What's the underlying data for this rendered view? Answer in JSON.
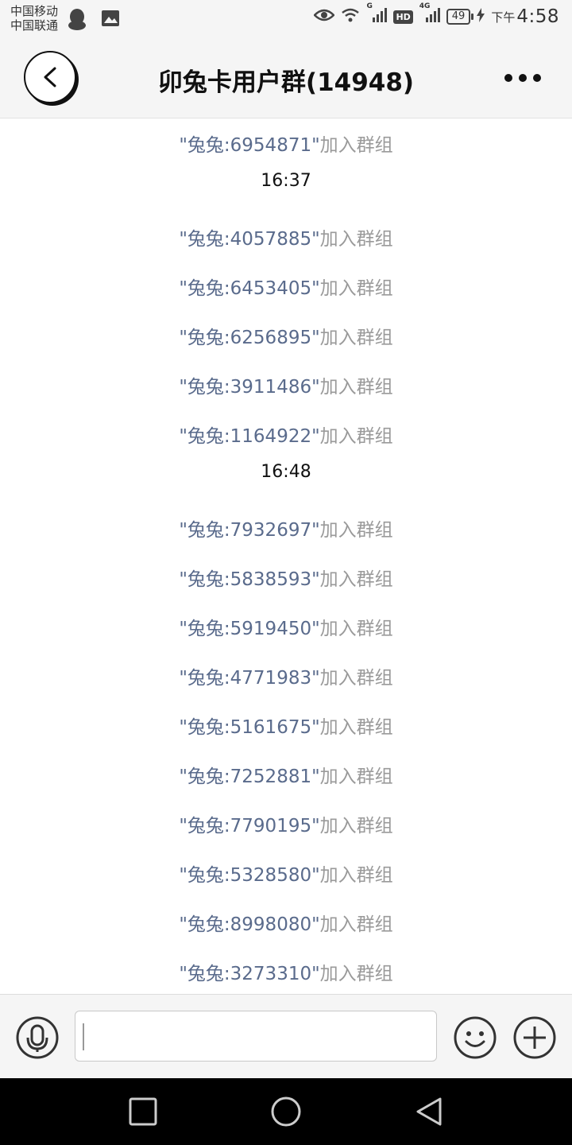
{
  "status_bar": {
    "carrier_1": "中国移动",
    "carrier_2": "中国联通",
    "network_1": "G",
    "network_2": "4G",
    "hd": "HD",
    "battery": "49",
    "ampm": "下午",
    "time": "4:58"
  },
  "header": {
    "title": "卯兔卡用户群(14948)",
    "back_icon": "chevron-left-icon",
    "more_icon": "more-dots-icon"
  },
  "messages": [
    {
      "type": "system",
      "name": "\"兔兔:6954871\"",
      "text": "加入群组"
    },
    {
      "type": "time",
      "text": "16:37"
    },
    {
      "type": "system",
      "name": "\"兔兔:4057885\"",
      "text": "加入群组"
    },
    {
      "type": "system",
      "name": "\"兔兔:6453405\"",
      "text": "加入群组"
    },
    {
      "type": "system",
      "name": "\"兔兔:6256895\"",
      "text": "加入群组"
    },
    {
      "type": "system",
      "name": "\"兔兔:3911486\"",
      "text": "加入群组"
    },
    {
      "type": "system",
      "name": "\"兔兔:1164922\"",
      "text": "加入群组"
    },
    {
      "type": "time",
      "text": "16:48"
    },
    {
      "type": "system",
      "name": "\"兔兔:7932697\"",
      "text": "加入群组"
    },
    {
      "type": "system",
      "name": "\"兔兔:5838593\"",
      "text": "加入群组"
    },
    {
      "type": "system",
      "name": "\"兔兔:5919450\"",
      "text": "加入群组"
    },
    {
      "type": "system",
      "name": "\"兔兔:4771983\"",
      "text": "加入群组"
    },
    {
      "type": "system",
      "name": "\"兔兔:5161675\"",
      "text": "加入群组"
    },
    {
      "type": "system",
      "name": "\"兔兔:7252881\"",
      "text": "加入群组"
    },
    {
      "type": "system",
      "name": "\"兔兔:7790195\"",
      "text": "加入群组"
    },
    {
      "type": "system",
      "name": "\"兔兔:5328580\"",
      "text": "加入群组"
    },
    {
      "type": "system",
      "name": "\"兔兔:8998080\"",
      "text": "加入群组"
    },
    {
      "type": "system",
      "name": "\"兔兔:3273310\"",
      "text": "加入群组"
    }
  ],
  "input_bar": {
    "voice_icon": "microphone-icon",
    "input_value": "",
    "emoji_icon": "smiley-icon",
    "plus_icon": "plus-icon"
  },
  "colors": {
    "name_link": "#5a6b8c",
    "system_text": "#9a9a9a",
    "bar_bg": "#f5f5f5"
  }
}
